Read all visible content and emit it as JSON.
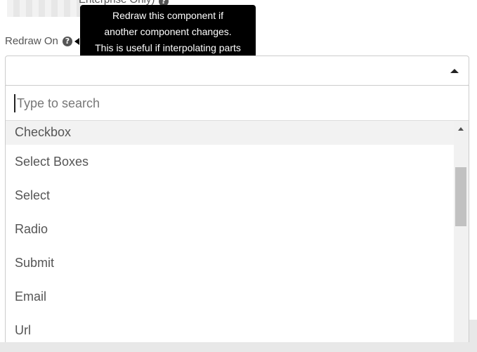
{
  "top_field": {
    "label": "Enterprise Only)"
  },
  "redraw": {
    "label": "Redraw On",
    "help_glyph": "?"
  },
  "tooltip": {
    "lines": [
      "Redraw this component if",
      "another component changes.",
      "This is useful if interpolating parts"
    ]
  },
  "search": {
    "placeholder": "Type to search",
    "value": ""
  },
  "options": [
    {
      "label": "Checkbox",
      "highlighted": true
    },
    {
      "label": "Select Boxes"
    },
    {
      "label": "Select"
    },
    {
      "label": "Radio"
    },
    {
      "label": "Submit"
    },
    {
      "label": "Email"
    },
    {
      "label": "Url"
    }
  ],
  "colors": {
    "tooltip_bg": "#000000",
    "highlight": "#f2f2f2",
    "scroll_thumb": "#c1c1c1"
  },
  "icons": {
    "help": "question-circle-icon",
    "caret": "caret-up-icon",
    "scroll_up": "scroll-up-arrow-icon"
  }
}
